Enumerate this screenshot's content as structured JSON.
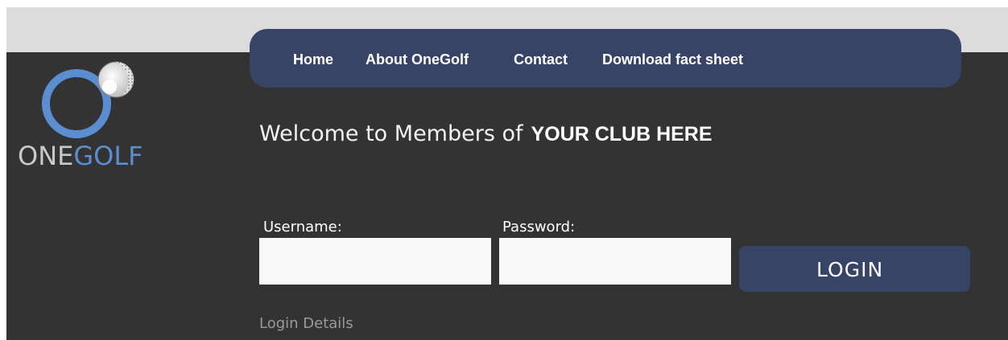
{
  "nav": {
    "items": [
      {
        "label": "Home"
      },
      {
        "label": "About OneGolf"
      },
      {
        "label": "Contact"
      },
      {
        "label": "Download fact sheet"
      }
    ]
  },
  "logo": {
    "text_part_one": "ONE",
    "text_part_two": "GOLF",
    "icon": "golf-ball-ring-icon"
  },
  "welcome": {
    "text": "Welcome to Members of",
    "club": "YOUR CLUB HERE"
  },
  "login_form": {
    "username_label": "Username:",
    "username_value": "",
    "password_label": "Password:",
    "password_value": "",
    "login_button": "LOGIN",
    "details_link": "Login Details"
  },
  "colors": {
    "nav_background": "#384466",
    "page_background": "#333333",
    "top_strip": "#dcdcdc",
    "logo_blue": "#5b8ed0",
    "logo_grey": "#c9c9c9"
  }
}
